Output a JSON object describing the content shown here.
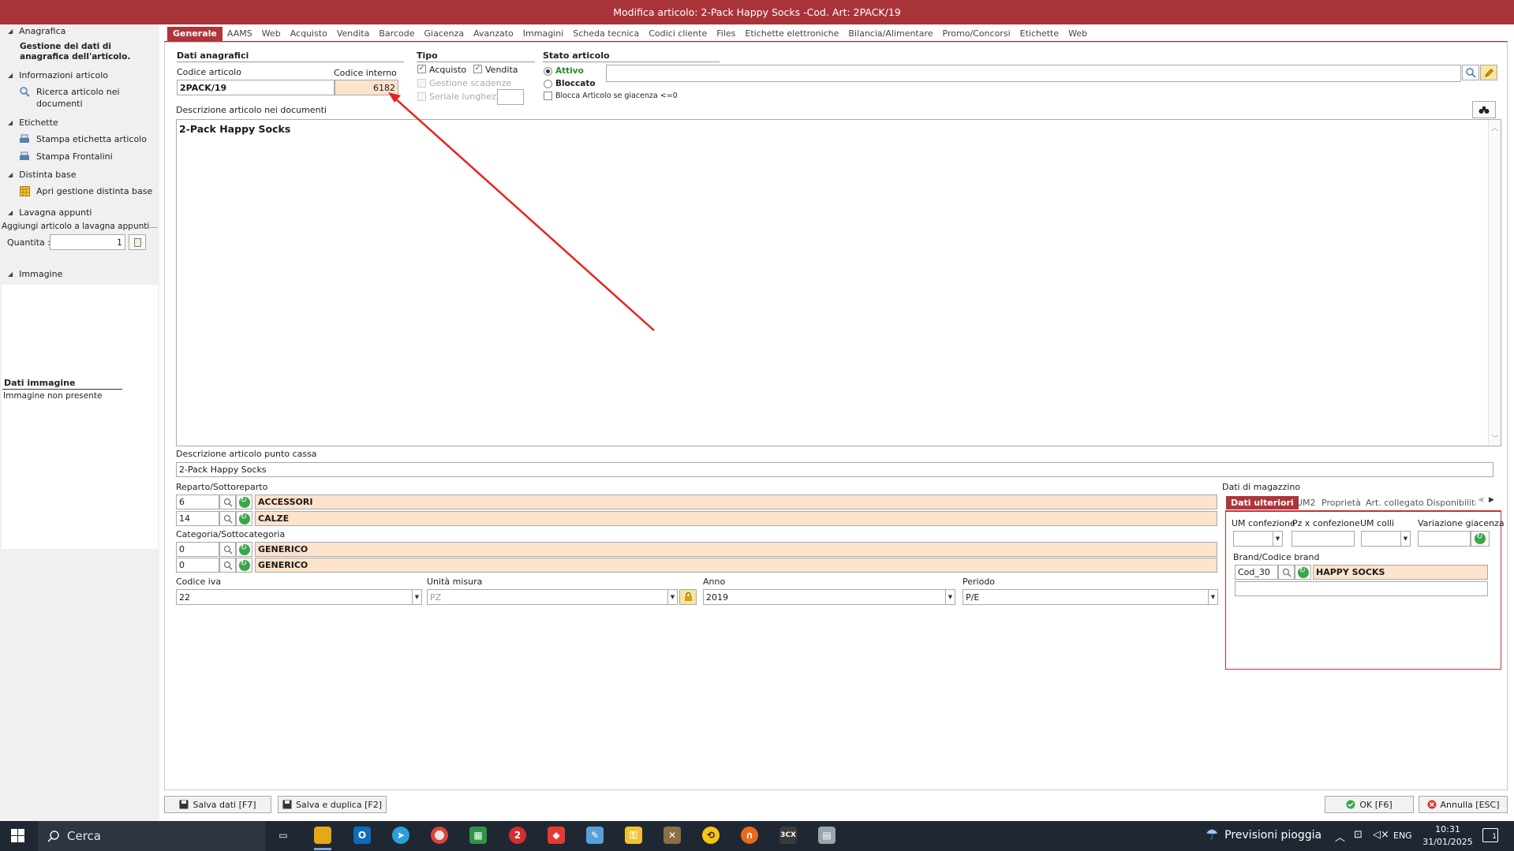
{
  "window": {
    "title": "Modifica articolo: 2-Pack Happy Socks  -Cod. Art: 2PACK/19"
  },
  "sidebar": {
    "sections": [
      {
        "label": "Anagrafica"
      },
      {
        "label": "Informazioni articolo"
      },
      {
        "label": "Etichette"
      },
      {
        "label": "Distinta base"
      },
      {
        "label": "Lavagna appunti"
      },
      {
        "label": "Immagine"
      }
    ],
    "anagrafica_desc": "Gestione dei dati di anagrafica dell'articolo.",
    "items": {
      "ricerca": "Ricerca articolo nei documenti",
      "stampa_etichetta": "Stampa etichetta articolo",
      "stampa_frontalini": "Stampa Frontalini",
      "distinta": "Apri gestione distinta base"
    },
    "lavagna": {
      "group_label": "Aggiungi articolo a lavagna appunti",
      "qty_label": "Quantita :",
      "qty_value": "1"
    },
    "immagine": {
      "header": "Dati immagine",
      "status": "Immagine non presente"
    }
  },
  "tabs": [
    "Generale",
    "AAMS",
    "Web",
    "Acquisto",
    "Vendita",
    "Barcode",
    "Giacenza",
    "Avanzato",
    "Immagini",
    "Scheda tecnica",
    "Codici cliente",
    "Files",
    "Etichette elettroniche",
    "Bilancia/Alimentare",
    "Promo/Concorsi",
    "Etichette",
    "Web"
  ],
  "active_tab": "Generale",
  "anagrafici": {
    "header": "Dati anagrafici",
    "codice_label": "Codice articolo",
    "codice_value": "2PACK/19",
    "interno_label": "Codice interno",
    "interno_value": "6182"
  },
  "tipo": {
    "header": "Tipo",
    "acquisto": "Acquisto",
    "vendita": "Vendita",
    "gestione_scadenze": "Gestione scadenze",
    "seriale": "Seriale lunghezza"
  },
  "stato": {
    "header": "Stato articolo",
    "attivo": "Attivo",
    "bloccato": "Bloccato",
    "blocca_giacenza": "Blocca Articolo se giacenza <=0",
    "attivo_color": "#2a8a2a"
  },
  "descrizione": {
    "label": "Descrizione articolo nei documenti",
    "value": "2-Pack Happy Socks",
    "cassa_label": "Descrizione articolo punto cassa",
    "cassa_value": "2-Pack Happy Socks"
  },
  "reparto": {
    "label": "Reparto/Sottoreparto",
    "rows": [
      {
        "code": "6",
        "name": "ACCESSORI"
      },
      {
        "code": "14",
        "name": "CALZE"
      }
    ]
  },
  "categoria": {
    "label": "Categoria/Sottocategoria",
    "rows": [
      {
        "code": "0",
        "name": "GENERICO"
      },
      {
        "code": "0",
        "name": "GENERICO"
      }
    ]
  },
  "fields": {
    "iva_label": "Codice iva",
    "iva_value": "22",
    "um_label": "Unità misura",
    "um_value": "PZ",
    "anno_label": "Anno",
    "anno_value": "2019",
    "periodo_label": "Periodo",
    "periodo_value": "P/E"
  },
  "magazzino": {
    "label": "Dati di magazzino",
    "tabs": [
      "Dati ulteriori",
      "UM2",
      "Proprietà",
      "Art. collegato",
      "Disponibilità/"
    ],
    "um_confezione": "UM confezione",
    "pz_confezione": "Pz x confezione",
    "um_colli": "UM colli",
    "variazione": "Variazione giacenza",
    "brand_label": "Brand/Codice brand",
    "brand_code": "Cod_30",
    "brand_name": "HAPPY SOCKS"
  },
  "buttons": {
    "salva": "Salva dati [F7]",
    "salva_duplica": "Salva e duplica [F2]",
    "ok": "OK [F6]",
    "annulla": "Annulla [ESC]"
  },
  "taskbar": {
    "search": "Cerca",
    "weather": "Previsioni pioggia",
    "lang": "ENG",
    "time": "10:31",
    "date": "31/01/2025",
    "notif": "1"
  },
  "annotation": {
    "color": "#e8231f"
  }
}
